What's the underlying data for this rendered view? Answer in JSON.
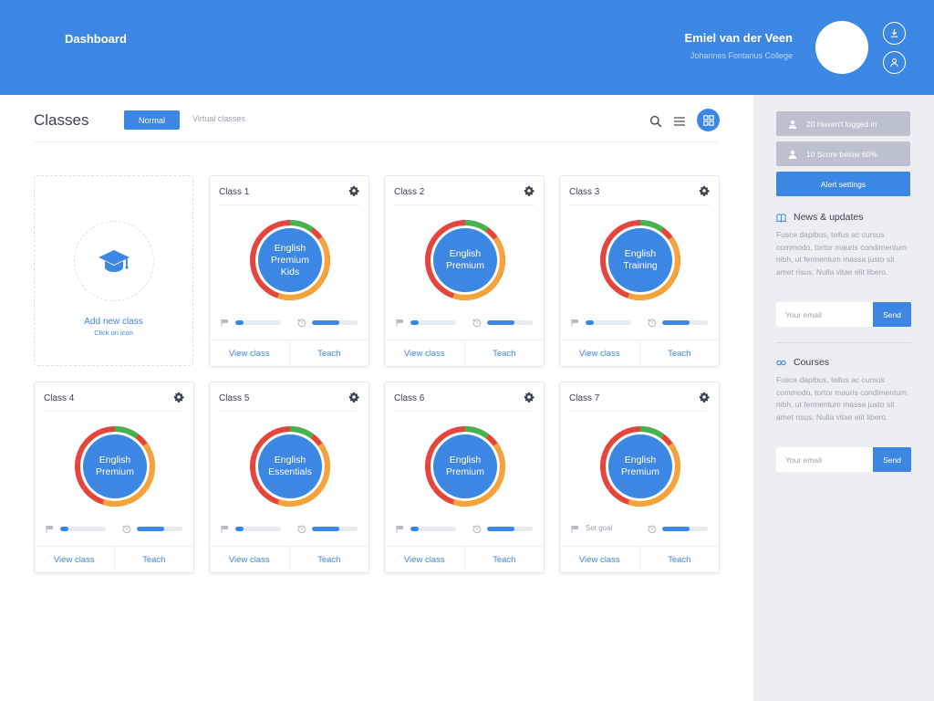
{
  "header": {
    "brand": "Dashboard",
    "user_name": "Emiel van der Veen",
    "user_school": "Johannes Fontanus College",
    "icons": [
      "download-icon",
      "user-icon"
    ]
  },
  "main": {
    "title": "Classes",
    "tabs": [
      {
        "label": "Normal",
        "active": true
      },
      {
        "label": "Virtual classes",
        "active": false
      }
    ],
    "add_card": {
      "label": "Add new class",
      "sub": "Click on icon"
    },
    "donut_colors": {
      "red": "#e5453c",
      "orange": "#f6a33a",
      "green": "#43b54b",
      "center": "#3d87e4"
    },
    "cards": [
      {
        "title": "Class 1",
        "course": "English Premium Kids",
        "progress_flag": 0.18,
        "progress_history": 0.6,
        "goal_text": "",
        "view_label": "View class",
        "teach_label": "Teach"
      },
      {
        "title": "Class 2",
        "course": "English Premium",
        "progress_flag": 0.18,
        "progress_history": 0.6,
        "goal_text": "",
        "view_label": "View class",
        "teach_label": "Teach"
      },
      {
        "title": "Class 3",
        "course": "English Training",
        "progress_flag": 0.18,
        "progress_history": 0.6,
        "goal_text": "",
        "view_label": "View class",
        "teach_label": "Teach"
      },
      {
        "title": "Class 4",
        "course": "English Premium",
        "progress_flag": 0.18,
        "progress_history": 0.6,
        "goal_text": "",
        "view_label": "View class",
        "teach_label": "Teach"
      },
      {
        "title": "Class 5",
        "course": "English Essentials",
        "progress_flag": 0.18,
        "progress_history": 0.6,
        "goal_text": "",
        "view_label": "View class",
        "teach_label": "Teach"
      },
      {
        "title": "Class 6",
        "course": "English Premium",
        "progress_flag": 0.18,
        "progress_history": 0.6,
        "goal_text": "",
        "view_label": "View class",
        "teach_label": "Teach"
      },
      {
        "title": "Class 7",
        "course": "English Premium",
        "progress_flag": 0,
        "progress_history": 0.6,
        "goal_text": "Set goal",
        "view_label": "View class",
        "teach_label": "Teach"
      }
    ]
  },
  "sidebar": {
    "alert_not_logged": "20 Haven't logged in",
    "alert_score": "10 Score below 60%",
    "alert_settings": "Alert settings",
    "news": {
      "title": "News & updates",
      "body": "Fusce dapibus, tellus ac cursus commodo, tortor mauris condimentum nibh, ut fermentum massa justo sit amet risus. Nulla vitae elit libero.",
      "placeholder": "Your email",
      "send": "Send"
    },
    "courses": {
      "title": "Courses",
      "body": "Fusce dapibus, tellus ac cursus commodo, tortor mauris condimentum nibh, ut fermentum massa justo sit amet risus. Nulla vitae elit libero.",
      "placeholder": "Your email",
      "send": "Send"
    }
  }
}
